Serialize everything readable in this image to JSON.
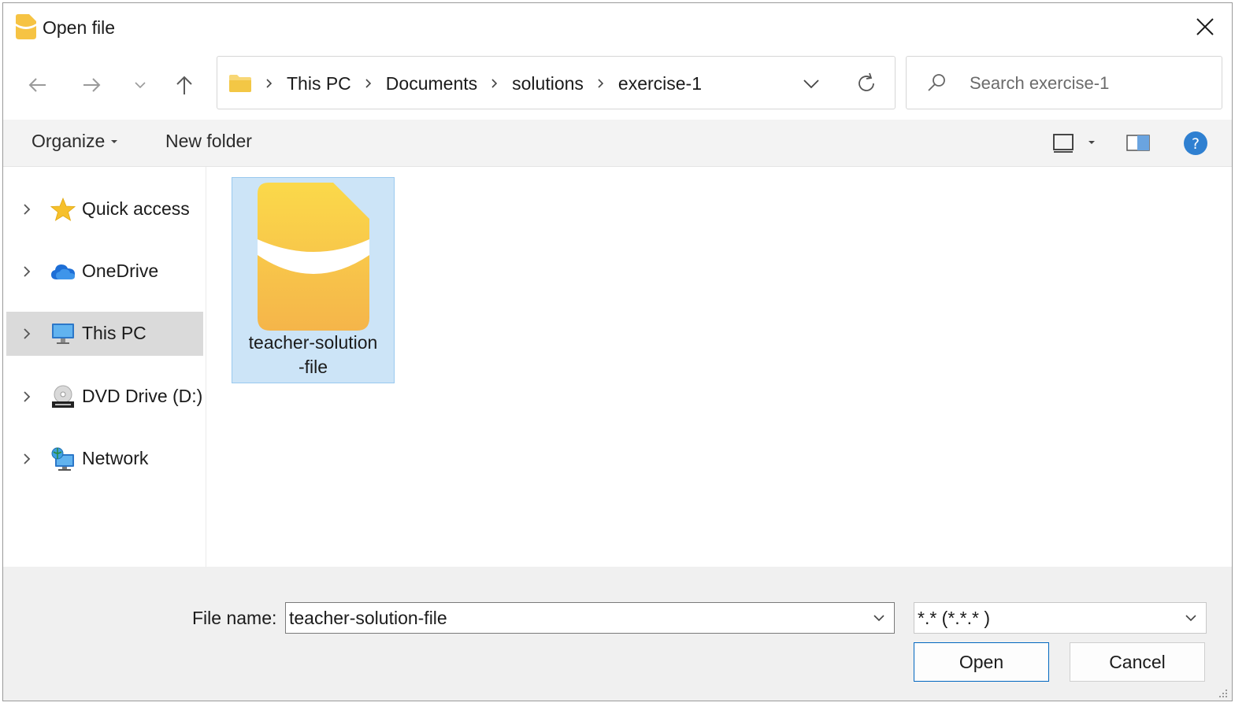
{
  "window": {
    "title": "Open file"
  },
  "address": {
    "crumbs": [
      "This PC",
      "Documents",
      "solutions",
      "exercise-1"
    ]
  },
  "search": {
    "placeholder": "Search exercise-1"
  },
  "toolbar": {
    "organize_label": "Organize",
    "new_folder_label": "New folder"
  },
  "sidebar": {
    "items": [
      {
        "label": "Quick access",
        "icon": "star-icon"
      },
      {
        "label": "OneDrive",
        "icon": "cloud-icon"
      },
      {
        "label": "This PC",
        "icon": "computer-icon",
        "active": true
      },
      {
        "label": "DVD Drive (D:)",
        "icon": "dvd-drive-icon"
      },
      {
        "label": "Network",
        "icon": "network-icon"
      }
    ]
  },
  "content": {
    "files": [
      {
        "name_line1": "teacher-solution",
        "name_line2": "-file",
        "icon": "app-file-icon",
        "selected": true
      }
    ]
  },
  "bottom": {
    "file_name_label": "File name:",
    "file_name_value": "teacher-solution-file",
    "file_type_value": "*.* (*.*.* )",
    "open_label": "Open",
    "cancel_label": "Cancel"
  },
  "colors": {
    "accent": "#0067c0",
    "selection": "#cce4f7",
    "help": "#2f80d1",
    "file_yellow": "#f7c94b"
  }
}
